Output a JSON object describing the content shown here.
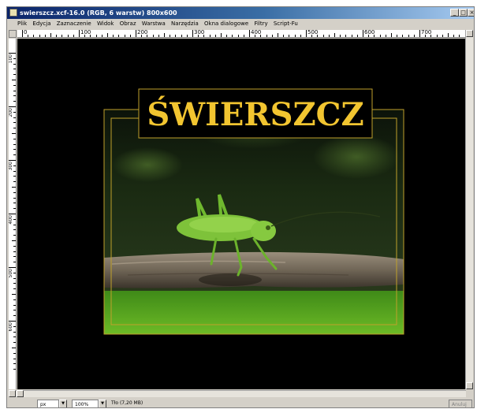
{
  "window": {
    "title": "swierszcz.xcf-16.0 (RGB, 6 warstw) 800x600",
    "controls": [
      "_",
      "□",
      "×"
    ]
  },
  "menu": {
    "items": [
      "Plik",
      "Edycja",
      "Zaznaczenie",
      "Widok",
      "Obraz",
      "Warstwa",
      "Narzędzia",
      "Okna dialogowe",
      "Filtry",
      "Script-Fu"
    ]
  },
  "ruler": {
    "horizontal_labels": [
      "0",
      "100",
      "200",
      "300",
      "400",
      "500",
      "600",
      "700"
    ],
    "vertical_labels": [
      "100",
      "200",
      "300",
      "400",
      "500",
      "600"
    ]
  },
  "image": {
    "title_text": "ŚWIERSZCZ",
    "title_color": "#f2c530",
    "frame_color": "#c0a12b",
    "background_color": "#000000",
    "subject": "grasshopper-on-branch"
  },
  "status": {
    "unit": "px",
    "zoom": "100%",
    "info": "Tło (7,20 MB)",
    "right_button": "Anuluj"
  }
}
